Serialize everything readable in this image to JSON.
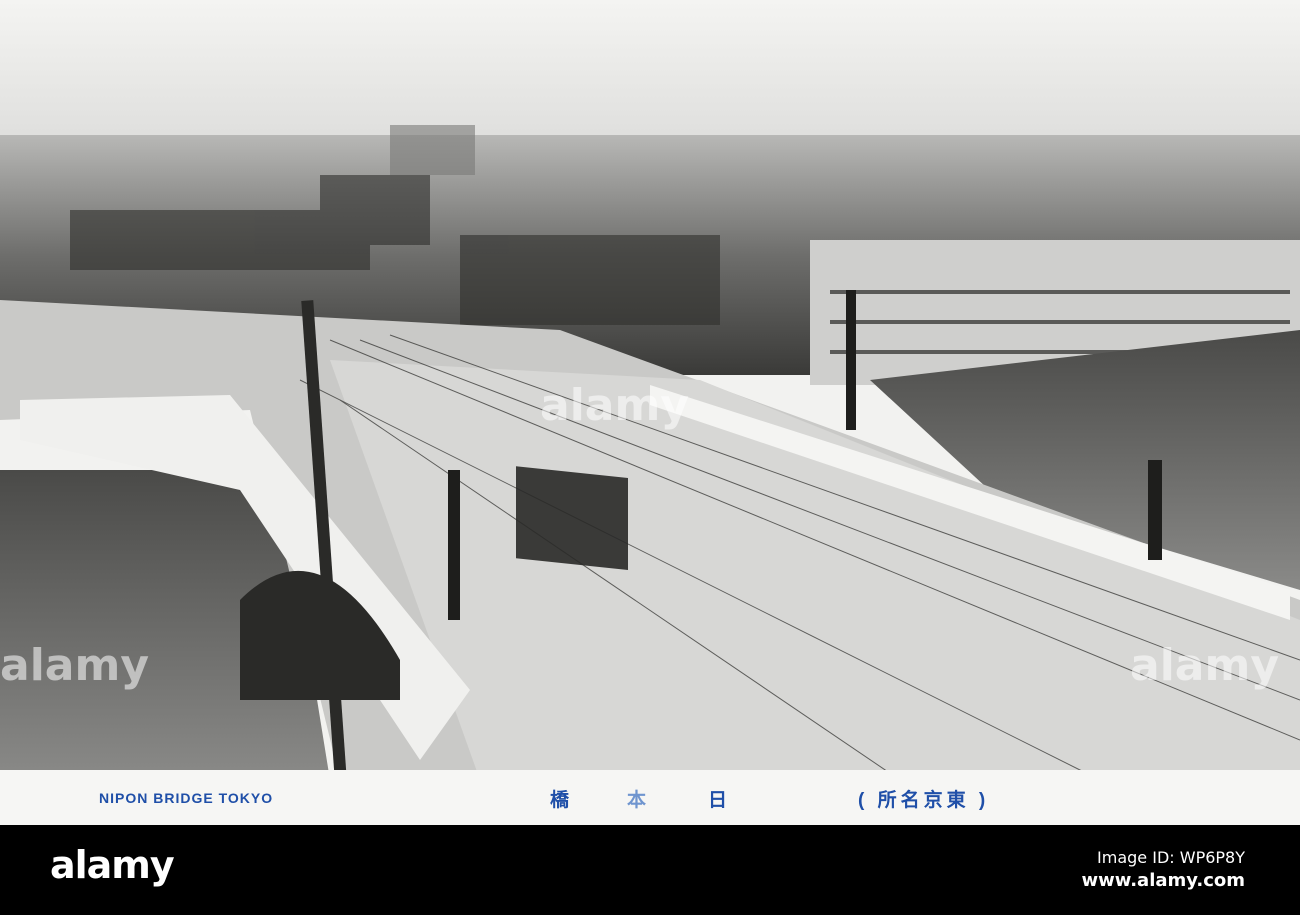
{
  "postcard": {
    "caption_en": "NIPON BRIDGE TOKYO",
    "caption_jp_1": "橋",
    "caption_jp_2": "本",
    "caption_jp_3": "日",
    "caption_jp_series": "( 所名京東 )"
  },
  "watermark": "alamy",
  "footer": {
    "logo": "alamy",
    "image_id": "Image ID: WP6P8Y",
    "site": "www.alamy.com"
  }
}
